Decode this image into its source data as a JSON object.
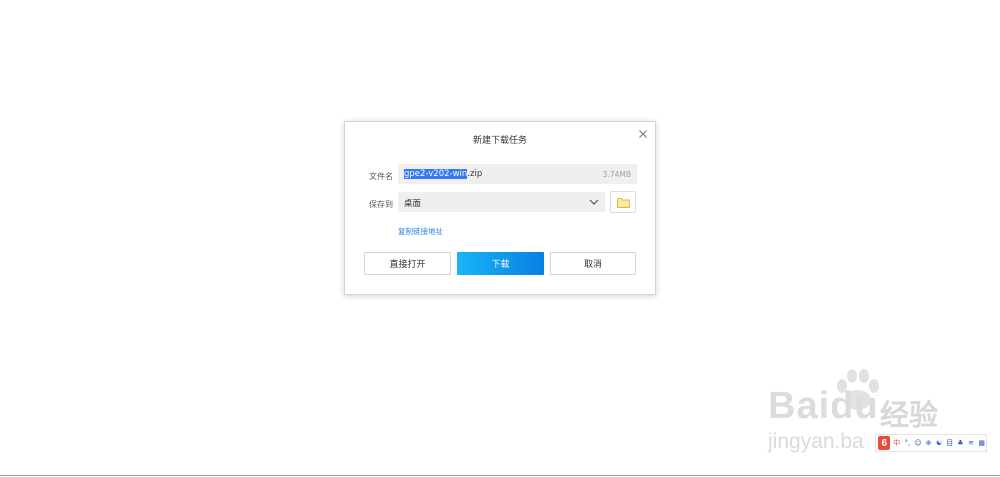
{
  "dialog": {
    "title": "新建下载任务",
    "close_icon": "close-icon",
    "filename_label": "文件名",
    "filename_selected": "gpe2-v202-win",
    "filename_rest": ".zip",
    "filesize": "3.74MB",
    "saveto_label": "保存到",
    "saveto_value": "桌面",
    "folder_icon": "folder-icon",
    "copy_link": "复制链接地址",
    "open_button": "直接打开",
    "download_button": "下载",
    "cancel_button": "取消"
  },
  "colors": {
    "accent": "#0a7fe2",
    "link": "#2a82e4",
    "selection": "#3478f6",
    "folder": "#f3c544"
  },
  "watermark": {
    "brand": "Baidu",
    "brand_cn": "经验",
    "url": "jingyan.ba"
  },
  "ime_bar": {
    "logo": "6",
    "items": [
      "中",
      "°,",
      "☺",
      "⊕",
      "☯",
      "目",
      "♣",
      "≋",
      "▦"
    ]
  }
}
